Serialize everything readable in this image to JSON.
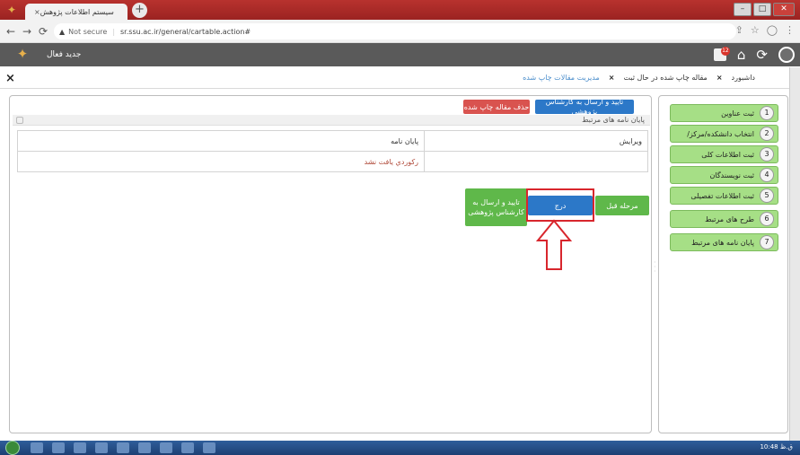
{
  "browser": {
    "tab_title": "سیستم اطلاعات پژوهش",
    "tab_close": "×",
    "new_tab": "+",
    "url_security": "Not secure",
    "url": "sr.ssu.ac.ir/general/cartable.action#"
  },
  "app": {
    "title": "جدید فعال",
    "notification_count": "12"
  },
  "breadcrumb": {
    "items": [
      "داشبورد",
      "مقاله چاپ شده در حال ثبت",
      "مدیریت مقالات چاپ شده"
    ],
    "separator": "×",
    "close_page": "×"
  },
  "steps": [
    {
      "num": "1",
      "label": "ثبت عناوین"
    },
    {
      "num": "2",
      "label": "انتخاب دانشکده/مرکز/"
    },
    {
      "num": "3",
      "label": "ثبت اطلاعات کلی"
    },
    {
      "num": "4",
      "label": "ثبت نویسندگان"
    },
    {
      "num": "5",
      "label": "ثبت اطلاعات تفصیلی"
    },
    {
      "num": "6",
      "label": "طرح های مرتبط"
    },
    {
      "num": "7",
      "label": "پایان نامه های مرتبط"
    }
  ],
  "main": {
    "confirm_button": "تایید و ارسال به کارشناس پژوهشی",
    "delete_button": "حذف مقاله چاپ شده",
    "section_title": "پایان نامه های مرتبط",
    "table": {
      "col_thesis": "پایان نامه",
      "col_edit": "ویرایش",
      "no_record": "رکوردي يافت نشد"
    },
    "prev_button": "مرحله قبل",
    "insert_button": "درج",
    "send_button": "تایید و ارسال به کارشناس پژوهشی"
  },
  "taskbar": {
    "clock": "10:48 ق.ظ"
  }
}
